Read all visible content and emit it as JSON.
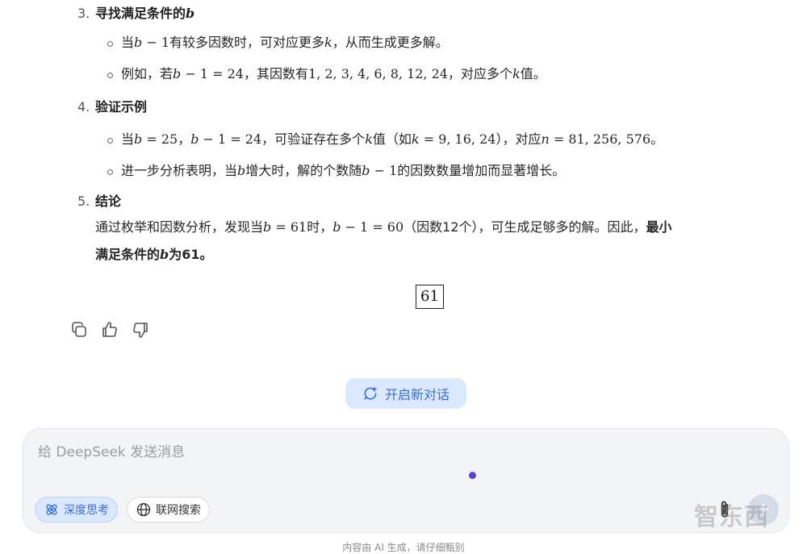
{
  "steps": {
    "s3": {
      "num": "3.",
      "title_text": "寻找满足条件的",
      "title_var": "b",
      "b1": {
        "pre": "当",
        "v1": "b",
        "mid": " − 1",
        "post": "有较多因数时，可对应更多",
        "v2": "k",
        "end": "，从而生成更多解。"
      },
      "b2": {
        "pre": "例如，若",
        "v1": "b",
        "math": " − 1 = 24",
        "post": "，其因数有",
        "list": "1, 2, 3, 4, 6, 8, 12, 24",
        "post2": "，对应多个",
        "v2": "k",
        "end": "值。"
      }
    },
    "s4": {
      "num": "4.",
      "title_text": "验证示例",
      "b1": {
        "pre": "当",
        "v1": "b",
        "m1": " = 25",
        "sep": "，",
        "v2": "b",
        "m2": " − 1 = 24",
        "mid": "，可验证存在多个",
        "v3": "k",
        "mid2": "值（如",
        "v4": "k",
        "m3": " = 9, 16, 24",
        "mid3": "），对应",
        "v5": "n",
        "m4": " = 81, 256, 576",
        "end": "。"
      },
      "b2": {
        "pre": "进一步分析表明，当",
        "v1": "b",
        "mid": "增大时，解的个数随",
        "v2": "b",
        "m1": " − 1",
        "end": "的因数数量增加而显著增长。"
      }
    },
    "s5": {
      "num": "5.",
      "title_text": "结论",
      "l1_pre": "通过枚举和因数分析，发现当",
      "l1_v1": "b",
      "l1_m1": " = 61",
      "l1_mid": "时，",
      "l1_v2": "b",
      "l1_m2": " − 1 = 60",
      "l1_post": "（因数12个），可生成足够多的解。因此，",
      "l1_bold": "最小",
      "l2_bold_pre": "满足条件的",
      "l2_var": "b",
      "l2_bold_post": "为61。"
    }
  },
  "answer_boxed": "61",
  "actions": {
    "copy": "copy-icon",
    "like": "thumbs-up-icon",
    "dislike": "thumbs-down-icon"
  },
  "new_chat": {
    "label": "开启新对话"
  },
  "composer": {
    "placeholder": "给 DeepSeek 发送消息",
    "deep_think": "深度思考",
    "web_search": "联网搜索"
  },
  "watermark": "智东西",
  "footer": "内容由 AI 生成，请仔细甄别",
  "colors": {
    "accent": "#3b6fd6",
    "chip_bg": "#dbe7fd",
    "caret": "#5b3fe0"
  }
}
